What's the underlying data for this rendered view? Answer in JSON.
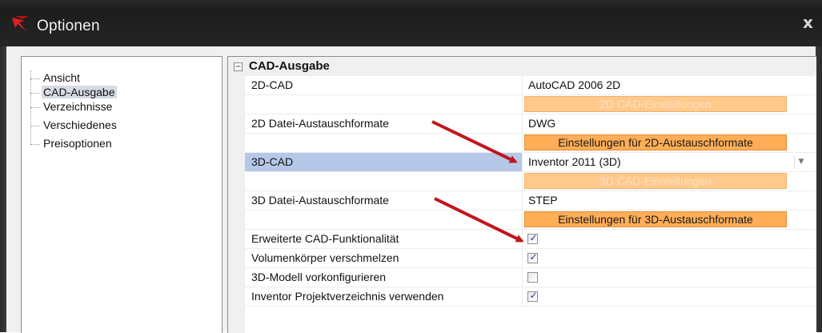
{
  "window": {
    "title": "Optionen",
    "close_label": "x"
  },
  "tree": {
    "items": [
      {
        "label": "Ansicht",
        "selected": false
      },
      {
        "label": "CAD-Ausgabe",
        "selected": true
      },
      {
        "label": "Verzeichnisse",
        "selected": false
      },
      {
        "label": "Verschiedenes",
        "selected": false
      },
      {
        "label": "Preisoptionen",
        "selected": false
      }
    ]
  },
  "grid": {
    "category": {
      "label": "CAD-Ausgabe",
      "collapse_glyph": "−"
    },
    "rows": {
      "cad2d": {
        "label": "2D-CAD",
        "value": "AutoCAD 2006 2D"
      },
      "btn_2d_settings": {
        "label": "2D CAD-Einstellungen"
      },
      "exch2d": {
        "label": "2D Datei-Austauschformate",
        "value": "DWG"
      },
      "btn_2d_exchange": {
        "label": "Einstellungen für 2D-Austauschformate"
      },
      "cad3d": {
        "label": "3D-CAD",
        "value": "Inventor 2011 (3D)",
        "arrow": "▼"
      },
      "btn_3d_settings": {
        "label": "3D CAD-Einstellungen"
      },
      "exch3d": {
        "label": "3D Datei-Austauschformate",
        "value": "STEP"
      },
      "btn_3d_exchange": {
        "label": "Einstellungen für 3D-Austauschformate"
      },
      "ext_cad": {
        "label": "Erweiterte CAD-Funktionalität",
        "checked": true,
        "mark": "✓"
      },
      "merge_solids": {
        "label": "Volumenkörper verschmelzen",
        "checked": true,
        "mark": "✓"
      },
      "preconfig_3d": {
        "label": "3D-Modell vorkonfigurieren",
        "checked": false,
        "mark": ""
      },
      "inv_project": {
        "label": "Inventor Projektverzeichnis verwenden",
        "checked": true,
        "mark": "✓"
      }
    }
  },
  "colors": {
    "titlebar": "#1f1f1f",
    "button_orange": "#ffae57",
    "button_disabled": "#ffc98b",
    "selected_row": "#b6c8e8",
    "annotation_arrow": "#c0161d"
  }
}
